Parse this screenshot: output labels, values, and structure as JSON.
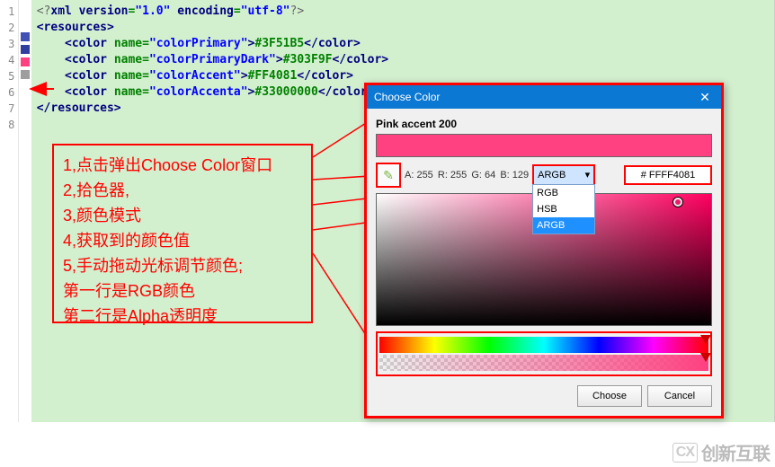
{
  "gutter": [
    "1",
    "2",
    "3",
    "4",
    "5",
    "6",
    "7",
    "8"
  ],
  "swatch_colors": [
    "",
    "",
    "#3F51B5",
    "#303F9F",
    "#FF4081",
    "#9e9e9e",
    "",
    ""
  ],
  "code": {
    "l1_pi": "<?xml version=\"1.0\" encoding=\"utf-8\"?>",
    "l2_open": "<resources>",
    "l3": {
      "name": "colorPrimary",
      "value": "#3F51B5"
    },
    "l4": {
      "name": "colorPrimaryDark",
      "value": "#303F9F"
    },
    "l5": {
      "name": "colorAccent",
      "value": "#FF4081"
    },
    "l6": {
      "name": "colorAccenta",
      "value": "#33000000"
    },
    "l7_close": "</resources>"
  },
  "annotation": {
    "l1": "1,点击弹出Choose Color窗口",
    "l2": "2,拾色器,",
    "l3": "3,颜色模式",
    "l4": "4,获取到的颜色值",
    "l5": "5,手动拖动光标调节颜色;",
    "l6": "   第一行是RGB颜色",
    "l7": "   第二行是Alpha透明度"
  },
  "dialog": {
    "title": "Choose Color",
    "swatch_name": "Pink accent 200",
    "a": "A: 255",
    "r": "R: 255",
    "g": "G: 64",
    "b": "B: 129",
    "mode_selected": "ARGB",
    "mode_options": [
      "RGB",
      "HSB",
      "ARGB"
    ],
    "hex": "# FFFF4081",
    "choose": "Choose",
    "cancel": "Cancel"
  },
  "watermark": "创新互联"
}
